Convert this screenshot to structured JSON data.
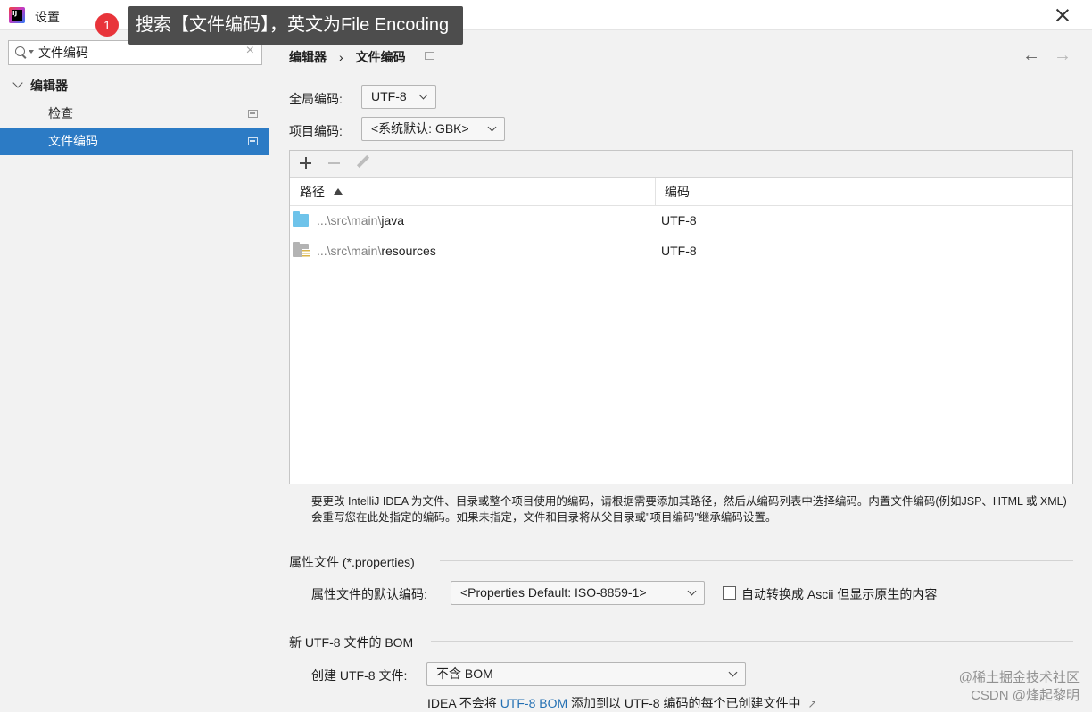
{
  "window": {
    "title": "设置",
    "logo_text": "IJ"
  },
  "annotation": {
    "badge": "1",
    "callout": "搜索【文件编码】，英文为File Encoding"
  },
  "sidebar": {
    "search_value": "文件编码",
    "search_clear": "×",
    "group_label": "编辑器",
    "items": [
      {
        "label": "检查",
        "selected": false
      },
      {
        "label": "文件编码",
        "selected": true
      }
    ]
  },
  "breadcrumb": {
    "parent": "编辑器",
    "separator": "›",
    "current": "文件编码"
  },
  "nav": {
    "back": "←",
    "forward": "→"
  },
  "global_encoding": {
    "label": "全局编码:",
    "value": "UTF-8"
  },
  "project_encoding": {
    "label": "项目编码:",
    "value": "<系统默认: GBK>"
  },
  "table": {
    "columns": [
      "路径",
      "编码"
    ],
    "rows": [
      {
        "path_prefix": "...\\src\\main\\",
        "path_name": "java",
        "encoding": "UTF-8",
        "icon": "source-folder-icon"
      },
      {
        "path_prefix": "...\\src\\main\\",
        "path_name": "resources",
        "encoding": "UTF-8",
        "icon": "resources-folder-icon"
      }
    ]
  },
  "help_text": "要更改 IntelliJ IDEA 为文件、目录或整个项目使用的编码，请根据需要添加其路径，然后从编码列表中选择编码。内置文件编码(例如JSP、HTML 或 XML)会重写您在此处指定的编码。如果未指定，文件和目录将从父目录或\"项目编码\"继承编码设置。",
  "properties": {
    "section_title": "属性文件 (*.properties)",
    "default_label": "属性文件的默认编码:",
    "default_value": "<Properties Default: ISO-8859-1>",
    "ascii_label": "自动转换成 Ascii 但显示原生的内容",
    "ascii_checked": false
  },
  "bom": {
    "section_title": "新 UTF-8 文件的 BOM",
    "create_label": "创建 UTF-8 文件:",
    "create_value": "不含 BOM",
    "note_prefix": "IDEA 不会将 ",
    "note_link": "UTF-8 BOM",
    "note_suffix": " 添加到以 UTF-8 编码的每个已创建文件中",
    "note_arrow": "↗"
  },
  "watermark": {
    "line1": "@稀土掘金技术社区",
    "line2": "CSDN @烽起黎明"
  }
}
